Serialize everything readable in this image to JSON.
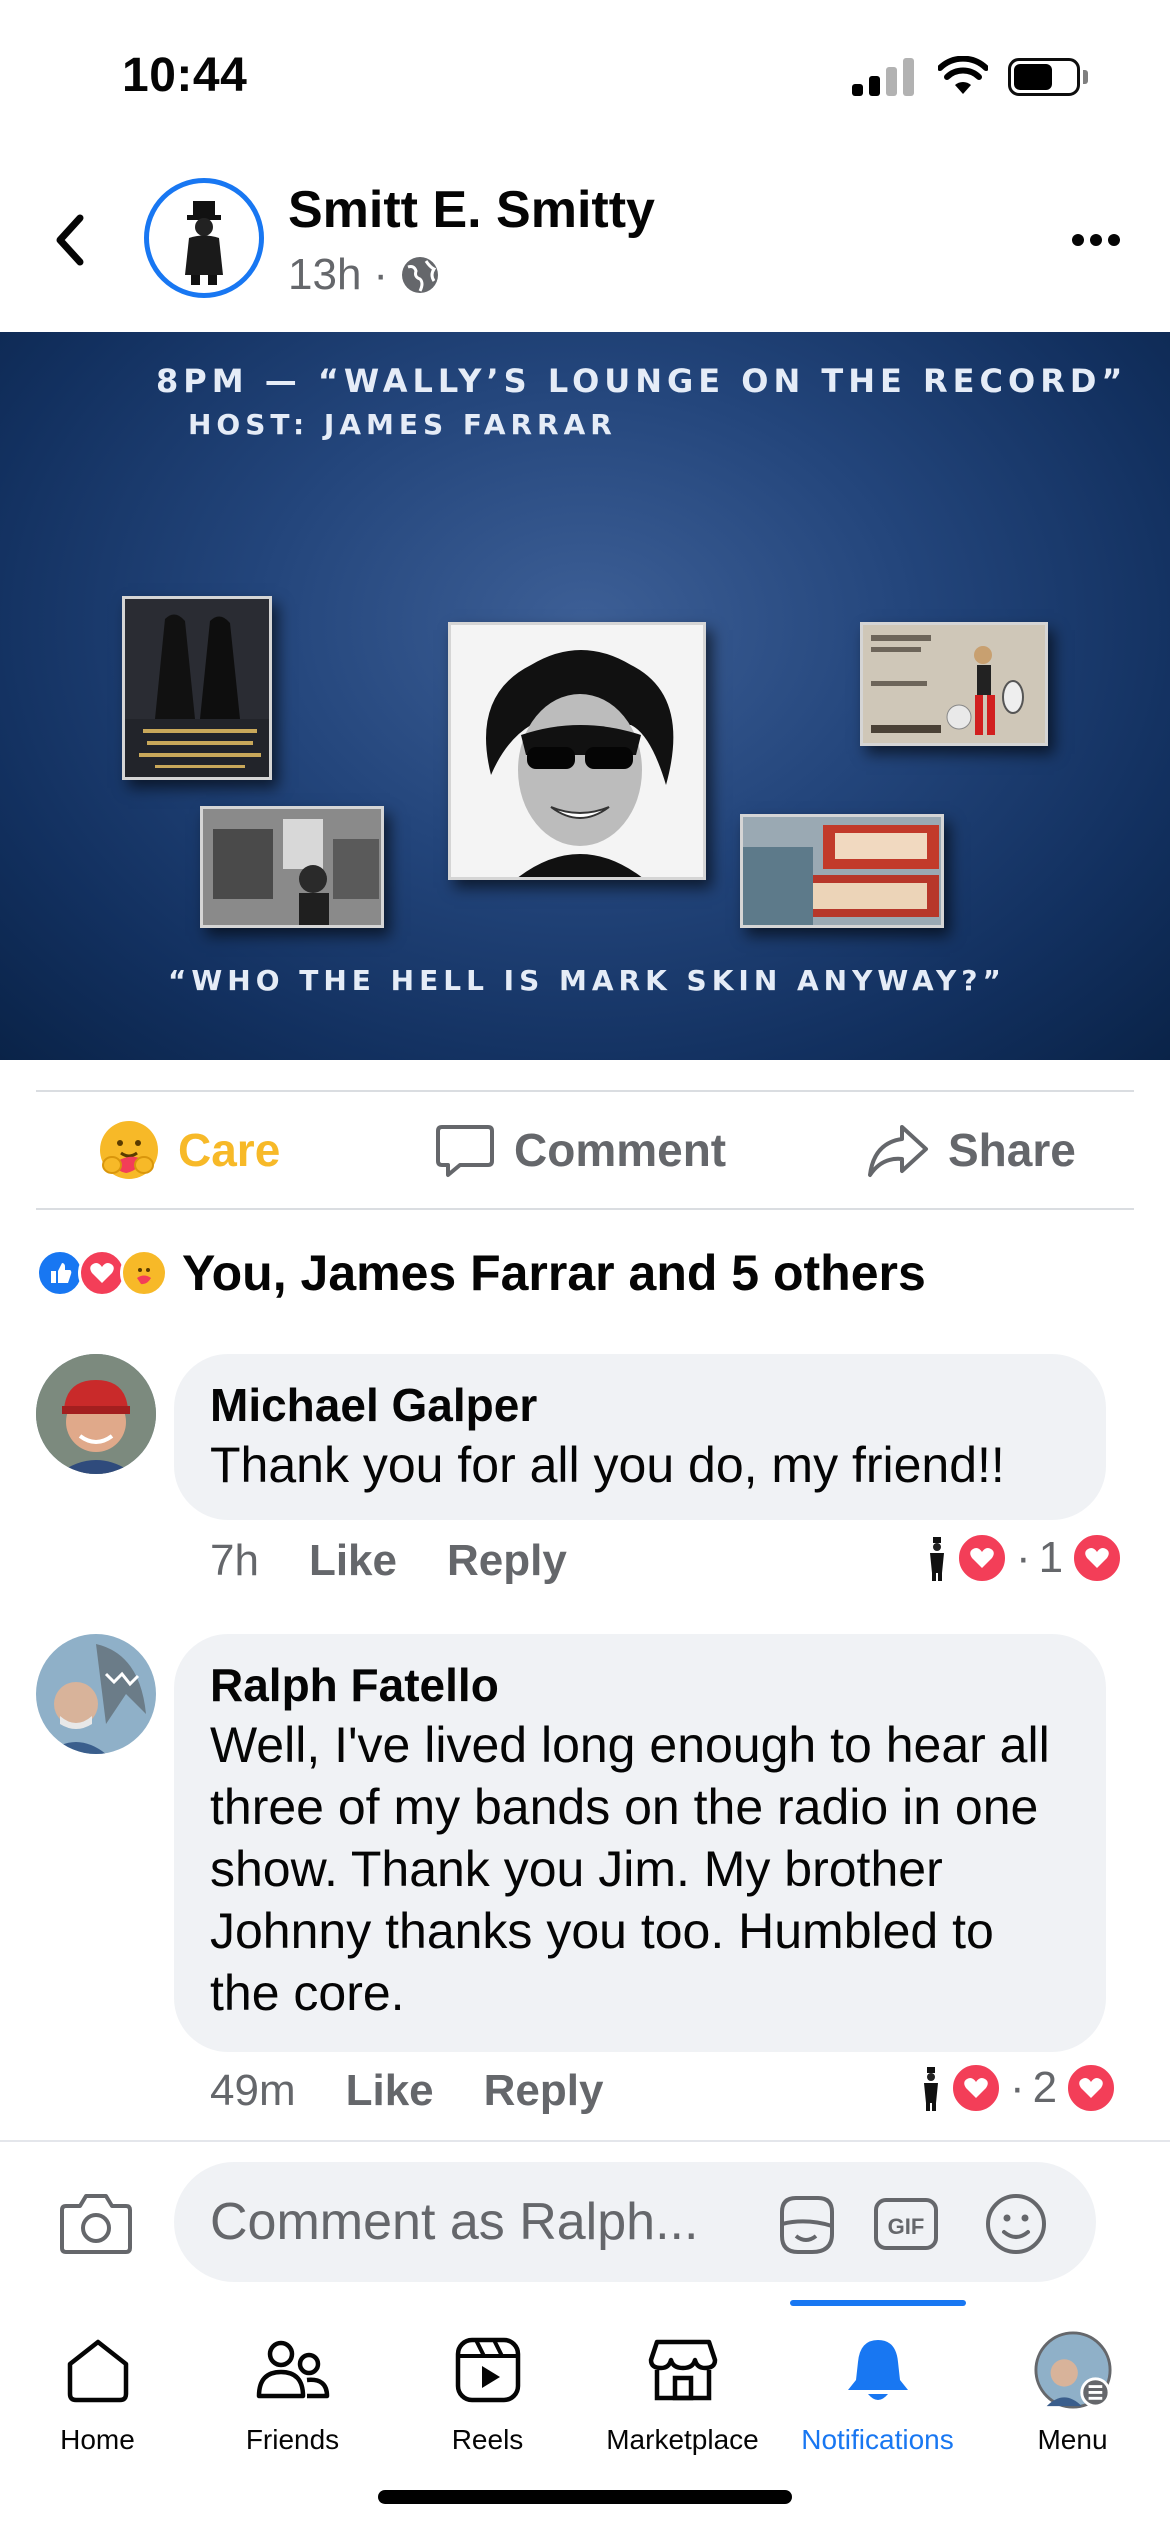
{
  "status_bar": {
    "time": "10:44"
  },
  "post": {
    "author": "Smitt E. Smitty",
    "time": "13h",
    "audience_icon": "globe-icon"
  },
  "banner": {
    "line1": "8PM — “WALLY’S LOUNGE ON THE RECORD”",
    "line2": "HOST:   JAMES FARRAR",
    "line3": "“WHO THE HELL IS MARK SKIN ANYWAY?”"
  },
  "actions": {
    "care": "Care",
    "comment": "Comment",
    "share": "Share"
  },
  "reactions": {
    "summary": "You, James Farrar and 5 others"
  },
  "comments": [
    {
      "name": "Michael Galper",
      "text": "Thank you for all you do, my friend!!",
      "time": "7h",
      "like": "Like",
      "reply": "Reply",
      "reaction_count": "1"
    },
    {
      "name": "Ralph Fatello",
      "text": "Well, I've lived long enough to hear all three of my bands on the radio in one show. Thank you Jim. My brother Johnny thanks you too. Humbled to the core.",
      "time": "49m",
      "like": "Like",
      "reply": "Reply",
      "reaction_count": "2"
    }
  ],
  "composer": {
    "placeholder": "Comment as Ralph..."
  },
  "tabs": [
    {
      "label": "Home"
    },
    {
      "label": "Friends"
    },
    {
      "label": "Reels"
    },
    {
      "label": "Marketplace"
    },
    {
      "label": "Notifications"
    },
    {
      "label": "Menu"
    }
  ],
  "colors": {
    "accent": "#1877f2",
    "care": "#f7b928",
    "love": "#f33e58",
    "muted": "#65676b"
  }
}
